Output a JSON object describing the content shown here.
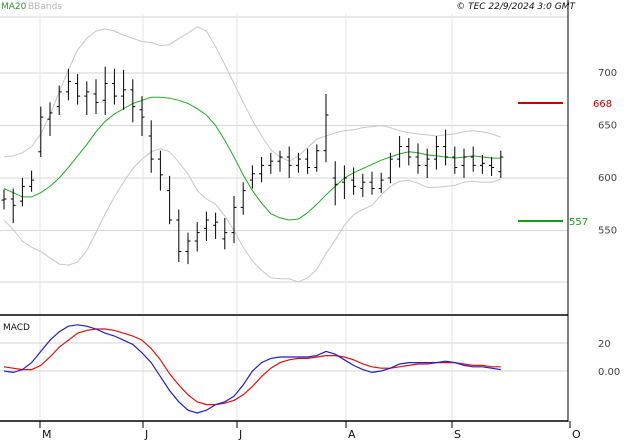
{
  "header": {
    "legend_ma": "MA20",
    "legend_bb": "BBands",
    "copyright": "© TEC 22/9/2024 3:0 GMT"
  },
  "colors": {
    "ma": "#22aa22",
    "bbands": "#c8c8c8",
    "bars": "#000000",
    "macd": "#1f1fcc",
    "signal": "#dd1111",
    "grid": "#d6d6d6",
    "resistance": "#cc0000",
    "support": "#1a9a1a"
  },
  "levels": {
    "resistance": {
      "value": 668,
      "label": "668"
    },
    "support": {
      "value": 557,
      "label": "557"
    }
  },
  "macd_panel": {
    "title": "MACD"
  },
  "chart_data": [
    {
      "type": "ohlc",
      "x_labels": [
        "M",
        "J",
        "J",
        "A",
        "S",
        "O"
      ],
      "y_ticks": [
        550,
        600,
        650,
        700
      ],
      "ylim": [
        490,
        760
      ],
      "grid": true,
      "series": [
        {
          "name": "MA20",
          "y": [
            590,
            586,
            582,
            582,
            586,
            592,
            600,
            610,
            621,
            632,
            644,
            654,
            661,
            666,
            671,
            674,
            677,
            677,
            676,
            674,
            671,
            666,
            660,
            650,
            636,
            620,
            603,
            588,
            576,
            566,
            562,
            560,
            561,
            567,
            575,
            584,
            592,
            600,
            605,
            609,
            613,
            617,
            620,
            623,
            625,
            624,
            622,
            621,
            620,
            619,
            620,
            621,
            620,
            619,
            619
          ]
        },
        {
          "name": "BBands upper",
          "y": [
            620,
            621,
            624,
            630,
            642,
            660,
            682,
            703,
            722,
            733,
            740,
            742,
            740,
            736,
            733,
            730,
            729,
            726,
            727,
            733,
            738,
            744,
            740,
            725,
            708,
            690,
            672,
            655,
            640,
            627,
            620,
            616,
            621,
            629,
            637,
            640,
            643,
            645,
            646,
            648,
            649,
            650,
            648,
            645,
            643,
            642,
            641,
            640,
            641,
            642,
            644,
            645,
            644,
            642,
            639
          ]
        },
        {
          "name": "BBands lower",
          "y": [
            560,
            551,
            540,
            534,
            530,
            524,
            518,
            517,
            520,
            531,
            548,
            566,
            582,
            596,
            609,
            618,
            625,
            628,
            625,
            615,
            604,
            588,
            580,
            575,
            564,
            550,
            534,
            521,
            512,
            505,
            504,
            504,
            501,
            505,
            513,
            528,
            541,
            555,
            565,
            570,
            574,
            584,
            592,
            597,
            598,
            595,
            591,
            591,
            592,
            593,
            596,
            597,
            596,
            596,
            599
          ]
        },
        {
          "name": "Price",
          "bars": [
            {
              "o": 579,
              "h": 589,
              "l": 570,
              "c": 580
            },
            {
              "o": 580,
              "h": 590,
              "l": 557,
              "c": 574
            },
            {
              "o": 578,
              "h": 600,
              "l": 573,
              "c": 592
            },
            {
              "o": 592,
              "h": 607,
              "l": 587,
              "c": 598
            },
            {
              "o": 625,
              "h": 668,
              "l": 620,
              "c": 658
            },
            {
              "o": 656,
              "h": 672,
              "l": 640,
              "c": 662
            },
            {
              "o": 668,
              "h": 688,
              "l": 660,
              "c": 682
            },
            {
              "o": 682,
              "h": 704,
              "l": 674,
              "c": 692
            },
            {
              "o": 690,
              "h": 699,
              "l": 670,
              "c": 678
            },
            {
              "o": 678,
              "h": 692,
              "l": 660,
              "c": 682
            },
            {
              "o": 680,
              "h": 694,
              "l": 661,
              "c": 672
            },
            {
              "o": 674,
              "h": 706,
              "l": 660,
              "c": 690
            },
            {
              "o": 690,
              "h": 704,
              "l": 670,
              "c": 678
            },
            {
              "o": 678,
              "h": 703,
              "l": 665,
              "c": 684
            },
            {
              "o": 684,
              "h": 694,
              "l": 653,
              "c": 668
            },
            {
              "o": 665,
              "h": 678,
              "l": 640,
              "c": 658
            },
            {
              "o": 640,
              "h": 655,
              "l": 605,
              "c": 618
            },
            {
              "o": 618,
              "h": 626,
              "l": 588,
              "c": 603
            },
            {
              "o": 588,
              "h": 602,
              "l": 556,
              "c": 560
            },
            {
              "o": 560,
              "h": 570,
              "l": 520,
              "c": 530
            },
            {
              "o": 530,
              "h": 548,
              "l": 518,
              "c": 540
            },
            {
              "o": 540,
              "h": 558,
              "l": 530,
              "c": 548
            },
            {
              "o": 552,
              "h": 568,
              "l": 540,
              "c": 560
            },
            {
              "o": 555,
              "h": 567,
              "l": 542,
              "c": 558
            },
            {
              "o": 542,
              "h": 562,
              "l": 532,
              "c": 548
            },
            {
              "o": 548,
              "h": 583,
              "l": 538,
              "c": 572
            },
            {
              "o": 572,
              "h": 596,
              "l": 565,
              "c": 588
            },
            {
              "o": 598,
              "h": 612,
              "l": 590,
              "c": 604
            },
            {
              "o": 604,
              "h": 620,
              "l": 596,
              "c": 612
            },
            {
              "o": 612,
              "h": 624,
              "l": 604,
              "c": 616
            },
            {
              "o": 616,
              "h": 626,
              "l": 606,
              "c": 620
            },
            {
              "o": 620,
              "h": 630,
              "l": 600,
              "c": 612
            },
            {
              "o": 612,
              "h": 624,
              "l": 605,
              "c": 618
            },
            {
              "o": 618,
              "h": 628,
              "l": 604,
              "c": 610
            },
            {
              "o": 610,
              "h": 632,
              "l": 606,
              "c": 626
            },
            {
              "o": 626,
              "h": 680,
              "l": 615,
              "c": 660
            },
            {
              "o": 600,
              "h": 616,
              "l": 574,
              "c": 594
            },
            {
              "o": 596,
              "h": 612,
              "l": 580,
              "c": 600
            },
            {
              "o": 598,
              "h": 610,
              "l": 584,
              "c": 592
            },
            {
              "o": 590,
              "h": 604,
              "l": 582,
              "c": 596
            },
            {
              "o": 596,
              "h": 606,
              "l": 584,
              "c": 590
            },
            {
              "o": 590,
              "h": 605,
              "l": 586,
              "c": 598
            },
            {
              "o": 600,
              "h": 624,
              "l": 595,
              "c": 618
            },
            {
              "o": 618,
              "h": 640,
              "l": 610,
              "c": 630
            },
            {
              "o": 630,
              "h": 638,
              "l": 612,
              "c": 620
            },
            {
              "o": 620,
              "h": 633,
              "l": 604,
              "c": 612
            },
            {
              "o": 612,
              "h": 628,
              "l": 600,
              "c": 618
            },
            {
              "o": 618,
              "h": 640,
              "l": 608,
              "c": 630
            },
            {
              "o": 630,
              "h": 646,
              "l": 612,
              "c": 620
            },
            {
              "o": 620,
              "h": 630,
              "l": 604,
              "c": 610
            },
            {
              "o": 612,
              "h": 628,
              "l": 600,
              "c": 620
            },
            {
              "o": 620,
              "h": 630,
              "l": 606,
              "c": 612
            },
            {
              "o": 612,
              "h": 622,
              "l": 604,
              "c": 614
            },
            {
              "o": 612,
              "h": 620,
              "l": 602,
              "c": 610
            },
            {
              "o": 606,
              "h": 626,
              "l": 600,
              "c": 620
            }
          ]
        }
      ]
    },
    {
      "type": "line",
      "title": "MACD",
      "y_ticks": [
        0,
        20
      ],
      "y_tick_labels": [
        "0.00",
        "20"
      ],
      "ylim": [
        -35,
        45
      ],
      "grid": true,
      "series": [
        {
          "name": "MACD",
          "y": [
            0,
            -1,
            1,
            6,
            14,
            22,
            28,
            32,
            33,
            32,
            30,
            27,
            25,
            22,
            19,
            13,
            6,
            -4,
            -14,
            -22,
            -28,
            -30,
            -28,
            -24,
            -22,
            -18,
            -10,
            0,
            6,
            9,
            10,
            10,
            10,
            10,
            11,
            14,
            12,
            8,
            4,
            1,
            -1,
            0,
            2,
            5,
            6,
            6,
            6,
            6,
            7,
            6,
            4,
            3,
            3,
            2,
            1
          ]
        },
        {
          "name": "Signal",
          "y": [
            3,
            2,
            1,
            1,
            4,
            10,
            17,
            22,
            27,
            29,
            30,
            30,
            29,
            27,
            25,
            22,
            16,
            8,
            -2,
            -10,
            -17,
            -22,
            -24,
            -24,
            -23,
            -21,
            -17,
            -11,
            -4,
            2,
            6,
            8,
            9,
            9,
            10,
            11,
            11,
            10,
            8,
            5,
            3,
            2,
            2,
            3,
            4,
            5,
            5,
            6,
            6,
            6,
            5,
            4,
            4,
            3,
            3
          ]
        }
      ]
    }
  ]
}
